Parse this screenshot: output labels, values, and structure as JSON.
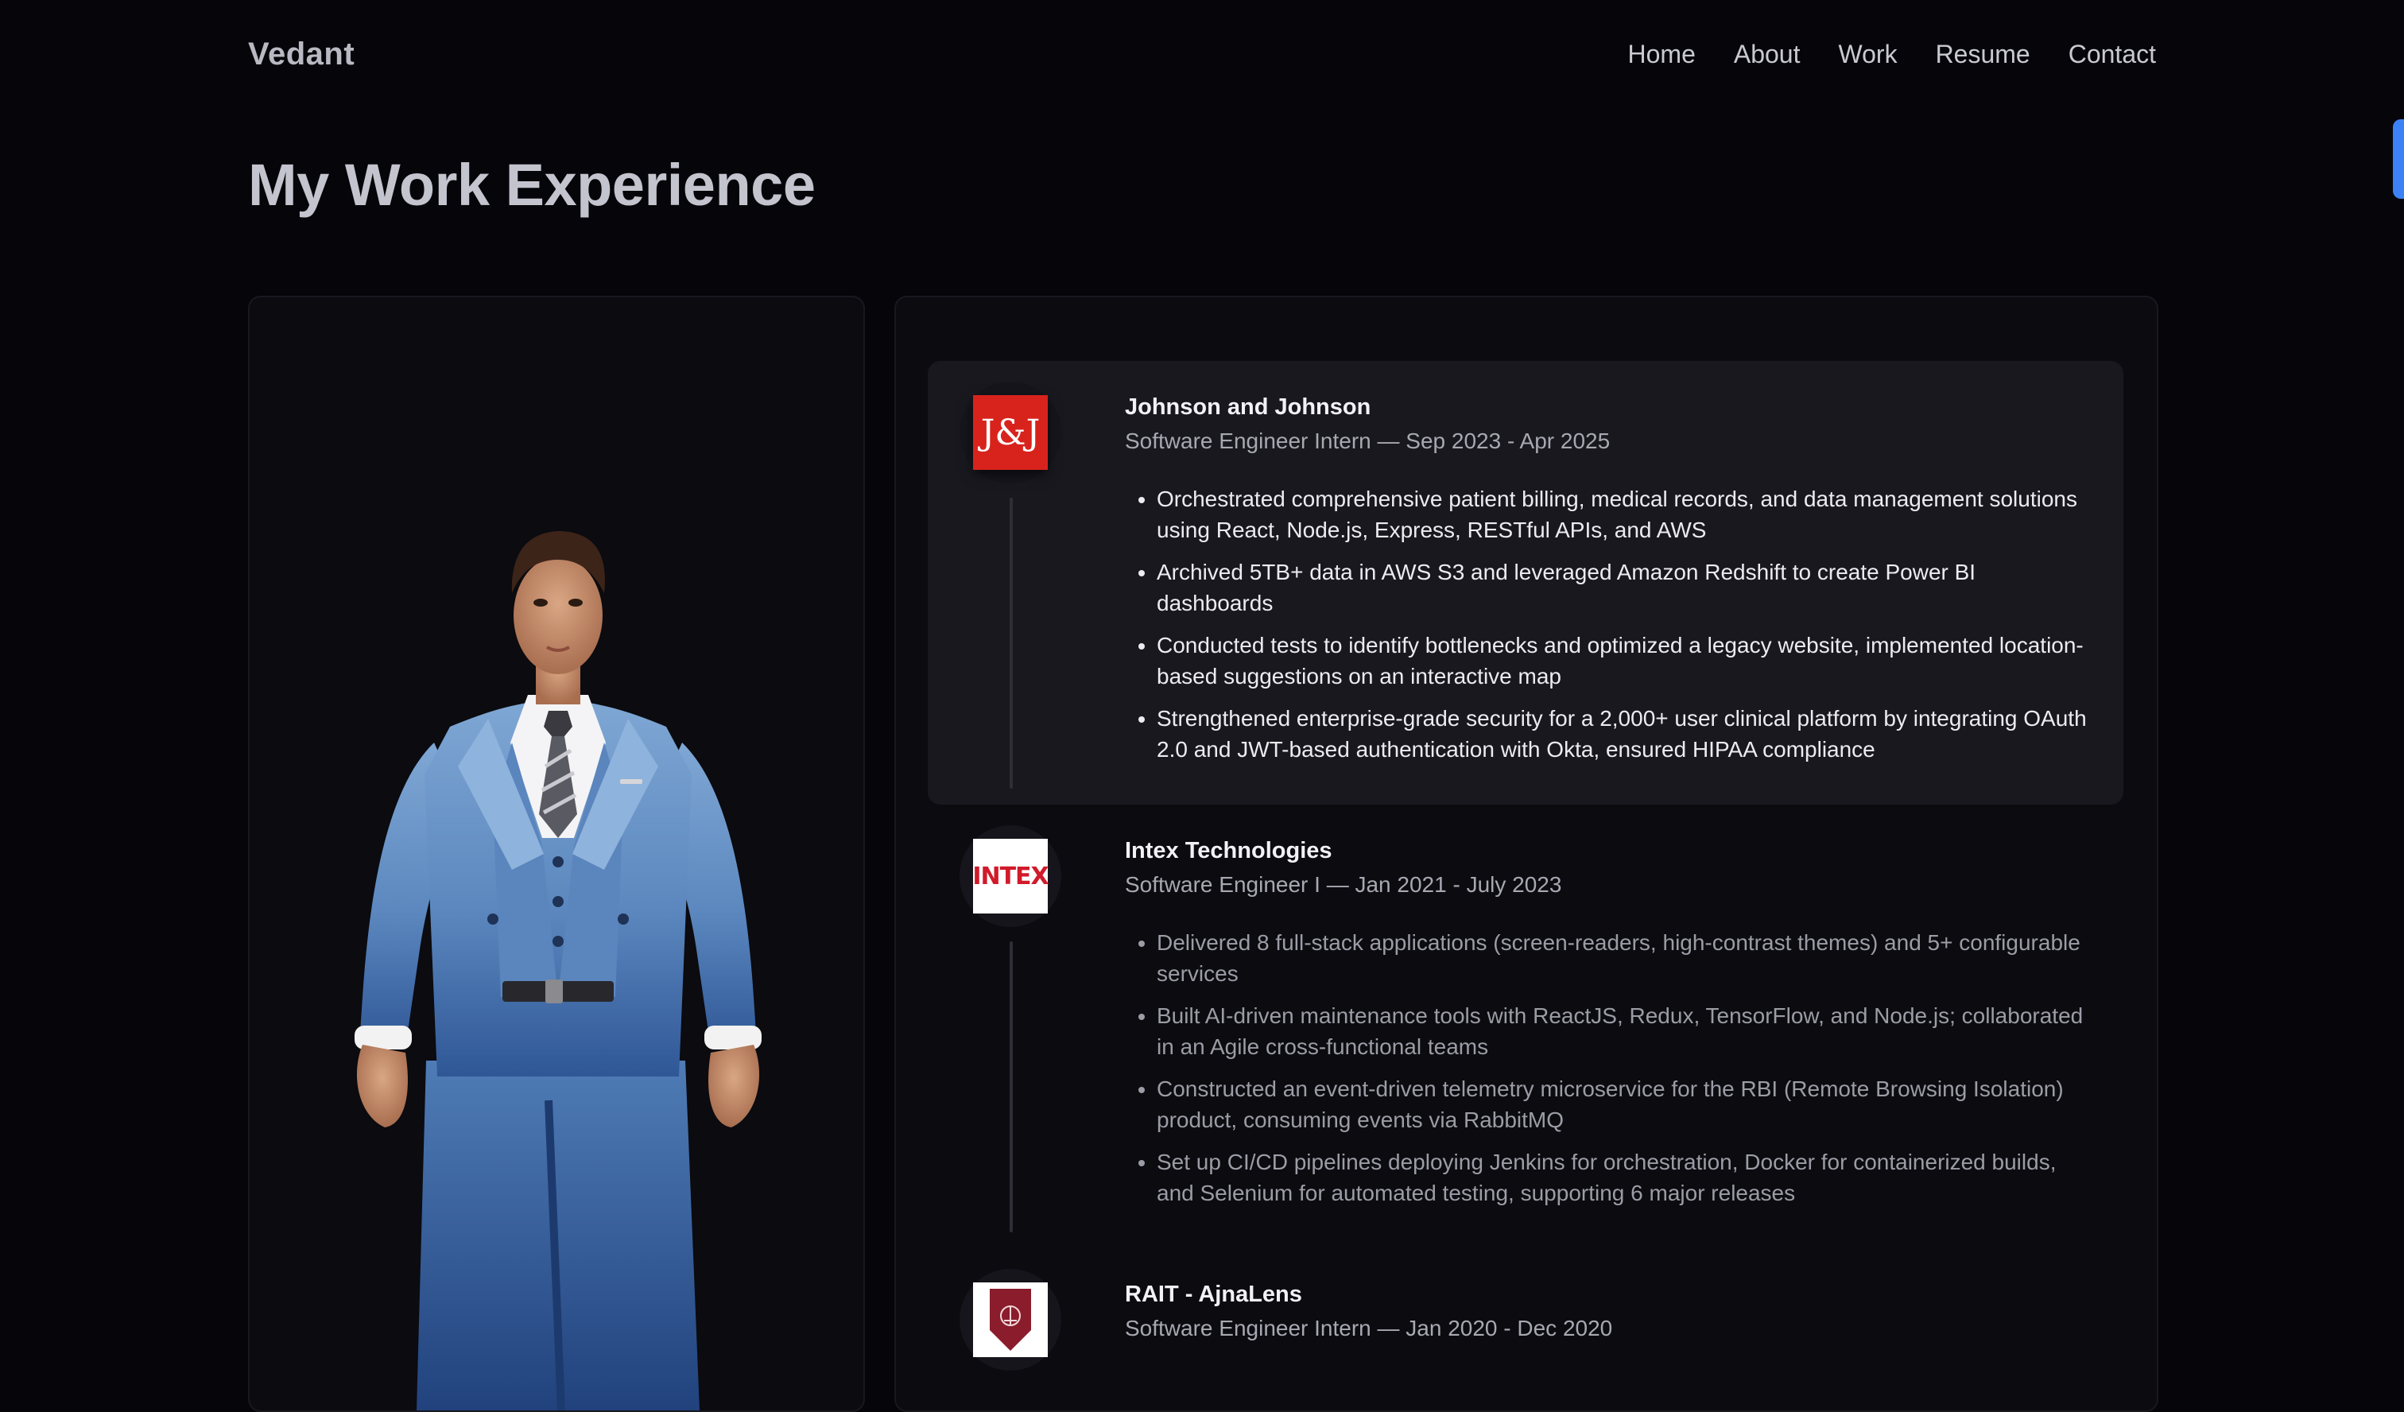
{
  "nav": {
    "brand": "Vedant",
    "links": [
      "Home",
      "About",
      "Work",
      "Resume",
      "Contact"
    ]
  },
  "page": {
    "title": "My Work Experience"
  },
  "jobs": [
    {
      "company": "Johnson and Johnson",
      "role": "Software Engineer Intern — Sep 2023 - Apr 2025",
      "logo_text": "J&J",
      "bullets": [
        "Orchestrated comprehensive patient billing, medical records, and data management solutions using React, Node.js, Express, RESTful APIs, and AWS",
        "Archived 5TB+ data in AWS S3 and leveraged Amazon Redshift to create Power BI dashboards",
        "Conducted tests to identify bottlenecks and optimized a legacy website, implemented location-based suggestions on an interactive map",
        "Strengthened enterprise-grade security for a 2,000+ user clinical platform by integrating OAuth 2.0 and JWT-based authentication with Okta, ensured HIPAA compliance"
      ]
    },
    {
      "company": "Intex Technologies",
      "role": "Software Engineer I — Jan 2021 - July 2023",
      "logo_text": "INTEX",
      "bullets": [
        "Delivered 8 full-stack applications (screen-readers, high-contrast themes) and 5+ configurable services",
        "Built AI-driven maintenance tools with ReactJS, Redux, TensorFlow, and Node.js; collaborated in an Agile cross-functional teams",
        "Constructed an event-driven telemetry microservice for the RBI (Remote Browsing Isolation) product, consuming events via RabbitMQ",
        "Set up CI/CD pipelines deploying Jenkins for orchestration, Docker for containerized builds, and Selenium for automated testing, supporting 6 major releases"
      ]
    },
    {
      "company": "RAIT - AjnaLens",
      "role": "Software Engineer Intern — Jan 2020 - Dec 2020"
    }
  ],
  "colors": {
    "background": "#06060a",
    "card": "#0b0b10",
    "active_card": "#18181e",
    "accent": "#3b82f6",
    "jj_red": "#d8231d",
    "intex_red": "#d11a2a",
    "rait_maroon": "#8b1c2c"
  }
}
